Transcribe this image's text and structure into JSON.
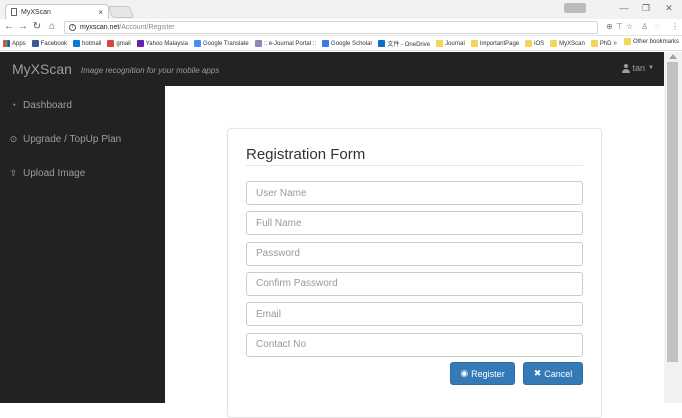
{
  "browser": {
    "tab_title": "MyXScan",
    "tab_close": "×",
    "url_host": "myxscan.net",
    "url_path": "/Account/Register",
    "window_controls": [
      "—",
      "❐",
      "✕"
    ],
    "bookmarks": [
      {
        "label": "Apps",
        "icon": "apps-icon",
        "cls": "bm-apps"
      },
      {
        "label": "Facebook",
        "icon": "facebook-icon",
        "cls": "bm-fb"
      },
      {
        "label": "hotmail",
        "icon": "hotmail-icon",
        "cls": "bm-hot"
      },
      {
        "label": "gmail",
        "icon": "gmail-icon",
        "cls": "bm-gm"
      },
      {
        "label": "Yahoo Malaysia",
        "icon": "yahoo-icon",
        "cls": "bm-ya"
      },
      {
        "label": "Google Translate",
        "icon": "translate-icon",
        "cls": "bm-gt"
      },
      {
        "label": ":: e-Journal Portal ::",
        "icon": "ejournal-icon",
        "cls": "bm-ej"
      },
      {
        "label": "Google Scholar",
        "icon": "scholar-icon",
        "cls": "bm-gs"
      },
      {
        "label": "文件 - OneDrive",
        "icon": "onedrive-icon",
        "cls": "bm-od"
      },
      {
        "label": "Journal",
        "icon": "folder-icon",
        "cls": "bm-folder"
      },
      {
        "label": "ImportantPage",
        "icon": "folder-icon",
        "cls": "bm-folder"
      },
      {
        "label": "iOS",
        "icon": "folder-icon",
        "cls": "bm-folder"
      },
      {
        "label": "MyXScan",
        "icon": "folder-icon",
        "cls": "bm-folder"
      },
      {
        "label": "PhD",
        "icon": "folder-icon",
        "cls": "bm-folder"
      }
    ],
    "bookmarks_more": "»",
    "other_bookmarks": "Other bookmarks"
  },
  "navbar": {
    "brand": "MyXScan",
    "tagline": "Image recognition for your mobile apps",
    "user": "tan"
  },
  "sidebar": {
    "items": [
      {
        "label": "Dashboard",
        "icon": "dashboard-icon",
        "glyph": "◔"
      },
      {
        "label": "Upgrade / TopUp Plan",
        "icon": "upgrade-icon",
        "glyph": "⊙"
      },
      {
        "label": "Upload Image",
        "icon": "upload-icon",
        "glyph": "⇪"
      }
    ]
  },
  "form": {
    "title": "Registration Form",
    "fields": [
      {
        "name": "username-field",
        "placeholder": "User Name",
        "type": "text"
      },
      {
        "name": "fullname-field",
        "placeholder": "Full Name",
        "type": "text"
      },
      {
        "name": "password-field",
        "placeholder": "Password",
        "type": "password"
      },
      {
        "name": "confirm-password-field",
        "placeholder": "Confirm Password",
        "type": "password"
      },
      {
        "name": "email-field",
        "placeholder": "Email",
        "type": "text"
      },
      {
        "name": "contact-field",
        "placeholder": "Contact No",
        "type": "text"
      }
    ],
    "register_label": "Register",
    "cancel_label": "Cancel"
  },
  "colors": {
    "navbar_bg": "#222222",
    "nav_text": "#9d9d9d",
    "primary_button": "#337ab7"
  }
}
